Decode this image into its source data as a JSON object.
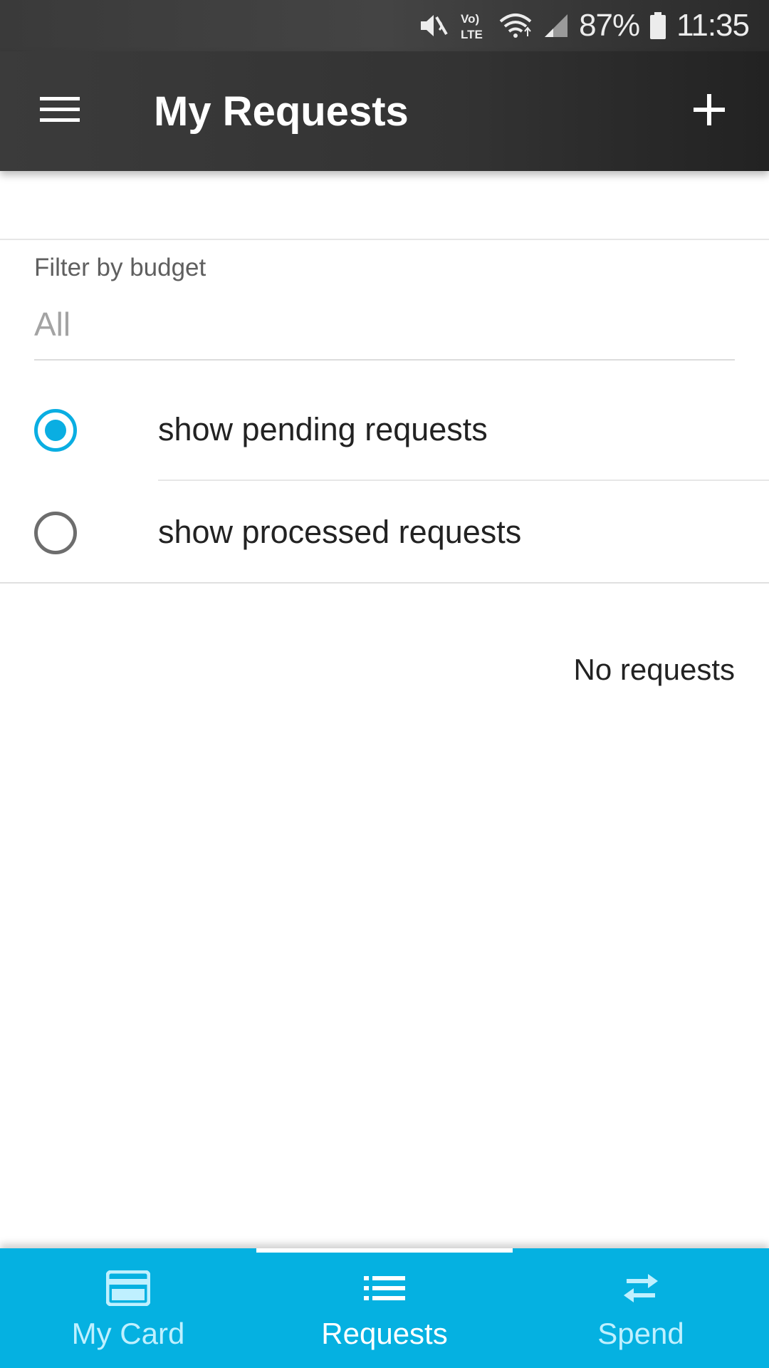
{
  "status_bar": {
    "battery": "87%",
    "time": "11:35",
    "network_label": "Vo) LTE"
  },
  "app_bar": {
    "title": "My Requests",
    "menu_icon": "hamburger-menu-icon",
    "add_icon": "plus-icon"
  },
  "filter": {
    "label": "Filter by budget",
    "selected": "All"
  },
  "options": [
    {
      "label": "show pending requests",
      "checked": true
    },
    {
      "label": "show processed requests",
      "checked": false
    }
  ],
  "empty_message": "No requests",
  "bottom_nav": {
    "items": [
      {
        "label": "My Card",
        "icon": "credit-card-icon",
        "active": false
      },
      {
        "label": "Requests",
        "icon": "list-icon",
        "active": true
      },
      {
        "label": "Spend",
        "icon": "swap-arrows-icon",
        "active": false
      }
    ]
  },
  "colors": {
    "accent": "#05b1e1",
    "app_bar": "#333333"
  }
}
